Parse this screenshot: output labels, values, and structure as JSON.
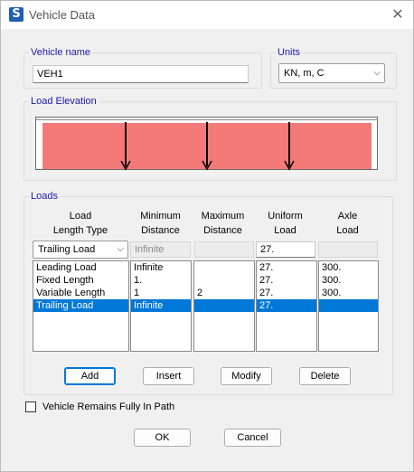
{
  "window": {
    "title": "Vehicle Data",
    "app_icon_letter": "S",
    "close_glyph": "✕"
  },
  "vehicle": {
    "group_label": "Vehicle name",
    "name": "VEH1"
  },
  "units": {
    "group_label": "Units",
    "selected": "KN, m, C"
  },
  "load_elevation": {
    "group_label": "Load Elevation",
    "bar_color": "#f47a7a",
    "axle_count": 3
  },
  "loads": {
    "group_label": "Loads",
    "columns": [
      {
        "line1": "Load",
        "line2": "Length Type"
      },
      {
        "line1": "Minimum",
        "line2": "Distance"
      },
      {
        "line1": "Maximum",
        "line2": "Distance"
      },
      {
        "line1": "Uniform",
        "line2": "Load"
      },
      {
        "line1": "Axle",
        "line2": "Load"
      }
    ],
    "edit_row": {
      "length_type": "Trailing Load",
      "min_distance": "Infinite",
      "max_distance": "",
      "uniform_load": "27.",
      "axle_load": ""
    },
    "rows": [
      {
        "type": "Leading Load",
        "min": "Infinite",
        "max": "",
        "uniform": "27.",
        "axle": "300."
      },
      {
        "type": "Fixed Length",
        "min": "1.",
        "max": "",
        "uniform": "27.",
        "axle": "300."
      },
      {
        "type": "Variable Length",
        "min": "1",
        "max": "2",
        "uniform": "27.",
        "axle": "300."
      },
      {
        "type": "Trailing Load",
        "min": "Infinite",
        "max": "",
        "uniform": "27.",
        "axle": ""
      }
    ],
    "selected_row_index": 3,
    "buttons": {
      "add": "Add",
      "insert": "Insert",
      "modify": "Modify",
      "delete": "Delete"
    }
  },
  "options": {
    "fully_in_path_label": "Vehicle Remains Fully In Path",
    "fully_in_path_checked": false
  },
  "footer": {
    "ok": "OK",
    "cancel": "Cancel"
  },
  "colors": {
    "selection": "#0078d7",
    "group_label": "#1a1aa6"
  }
}
